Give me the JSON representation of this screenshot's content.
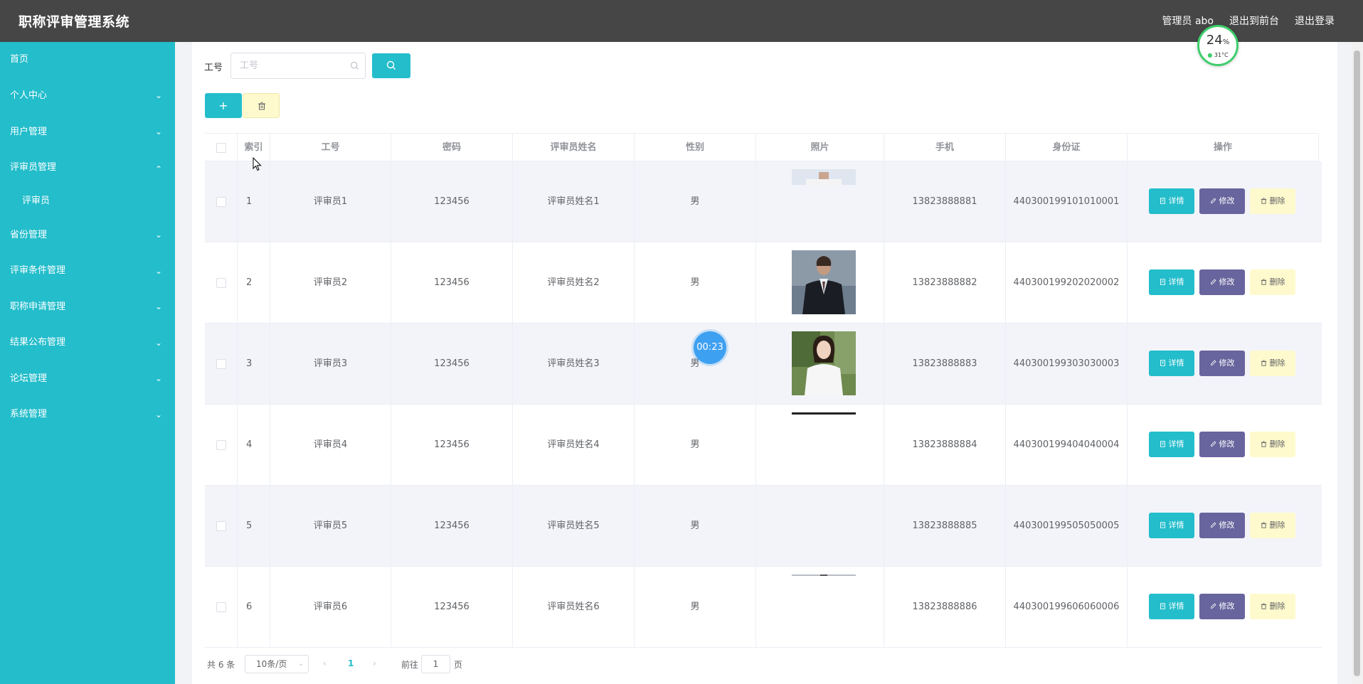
{
  "header": {
    "title": "职称评审管理系统",
    "admin": "管理员 abo",
    "front": "退出到前台",
    "logout": "退出登录"
  },
  "sidebar": {
    "items": [
      {
        "label": "首页",
        "chevron": ""
      },
      {
        "label": "个人中心",
        "chevron": "down"
      },
      {
        "label": "用户管理",
        "chevron": "down"
      },
      {
        "label": "评审员管理",
        "chevron": "up"
      },
      {
        "label": "评审员",
        "chevron": ""
      },
      {
        "label": "省份管理",
        "chevron": "down"
      },
      {
        "label": "评审条件管理",
        "chevron": "down"
      },
      {
        "label": "职称申请管理",
        "chevron": "down"
      },
      {
        "label": "结果公布管理",
        "chevron": "down"
      },
      {
        "label": "论坛管理",
        "chevron": "down"
      },
      {
        "label": "系统管理",
        "chevron": "down"
      }
    ]
  },
  "search": {
    "label": "工号",
    "placeholder": "工号",
    "value": ""
  },
  "toolbar": {
    "add_label": "+"
  },
  "table": {
    "headers": [
      "索引",
      "工号",
      "密码",
      "评审员姓名",
      "性别",
      "照片",
      "手机",
      "身份证",
      "操作"
    ],
    "rows": [
      {
        "index": "1",
        "id": "评审员1",
        "password": "123456",
        "name": "评审员姓名1",
        "gender": "男",
        "phone": "13823888881",
        "idcard": "440300199101010001",
        "photo": "partial-top"
      },
      {
        "index": "2",
        "id": "评审员2",
        "password": "123456",
        "name": "评审员姓名2",
        "gender": "男",
        "phone": "13823888882",
        "idcard": "440300199202020002",
        "photo": "man-suit"
      },
      {
        "index": "3",
        "id": "评审员3",
        "password": "123456",
        "name": "评审员姓名3",
        "gender": "男",
        "phone": "13823888883",
        "idcard": "440300199303030003",
        "photo": "woman-white"
      },
      {
        "index": "4",
        "id": "评审员4",
        "password": "123456",
        "name": "评审员姓名4",
        "gender": "男",
        "phone": "13823888884",
        "idcard": "440300199404040004",
        "photo": "line"
      },
      {
        "index": "5",
        "id": "评审员5",
        "password": "123456",
        "name": "评审员姓名5",
        "gender": "男",
        "phone": "13823888885",
        "idcard": "440300199505050005",
        "photo": "none"
      },
      {
        "index": "6",
        "id": "评审员6",
        "password": "123456",
        "name": "评审员姓名6",
        "gender": "男",
        "phone": "13823888886",
        "idcard": "440300199606060006",
        "photo": "thin-line"
      }
    ],
    "actions": {
      "detail": "详情",
      "edit": "修改",
      "remove": "删除"
    }
  },
  "pagination": {
    "total": "共 6 条",
    "page_size": "10条/页",
    "current_page": "1",
    "goto_prefix": "前往",
    "goto_value": "1",
    "goto_suffix": "页"
  },
  "widget": {
    "percent": "24",
    "percent_sign": "%",
    "temperature": "31°C"
  },
  "timer": {
    "value": "00:23"
  },
  "colors": {
    "accent": "#23bdcb",
    "header_bg": "#464646",
    "edit_button": "#68649d",
    "delete_button": "#fffacd"
  }
}
